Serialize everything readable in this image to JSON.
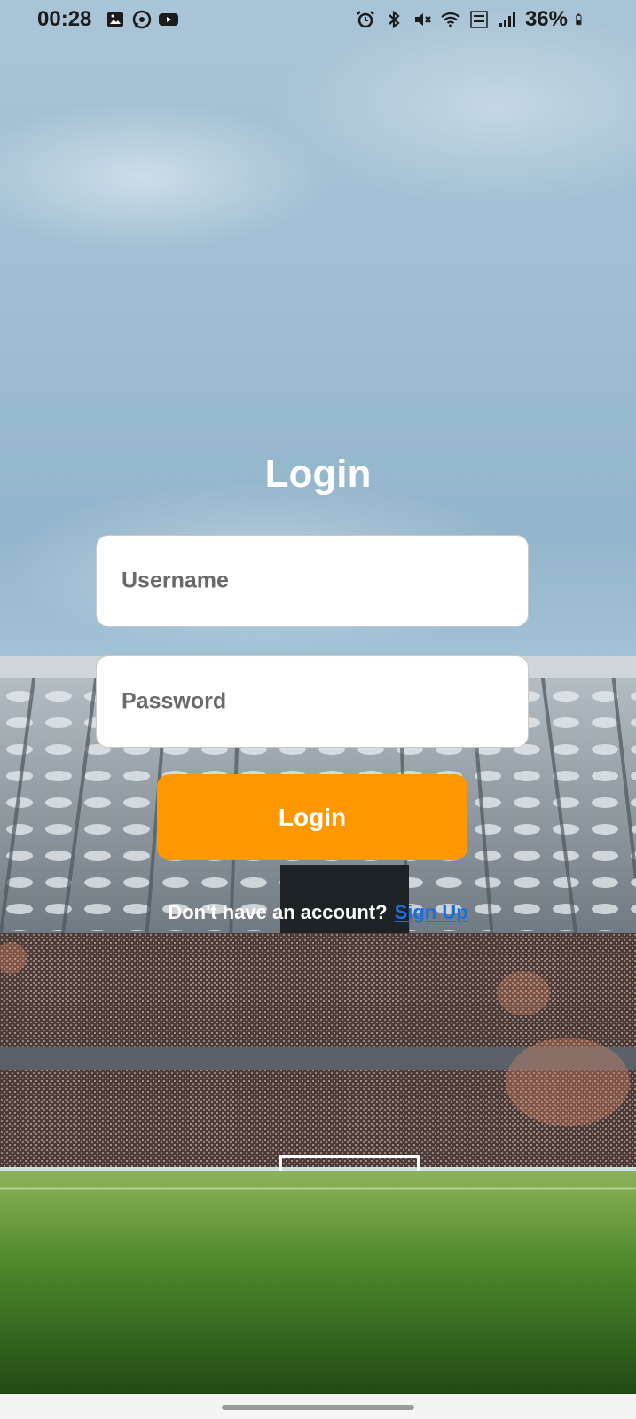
{
  "status_bar": {
    "time": "00:28",
    "battery_percent": "36%",
    "left_icons": [
      "gallery-icon",
      "whatsapp-icon",
      "youtube-icon"
    ],
    "right_icons": [
      "alarm-icon",
      "bluetooth-icon",
      "mute-icon",
      "wifi-icon",
      "volte-icon",
      "signal-icon",
      "battery-icon"
    ]
  },
  "login": {
    "title": "Login",
    "username_placeholder": "Username",
    "password_placeholder": "Password",
    "login_button": "Login",
    "signup_prompt": "Don't have an account?",
    "signup_link": "Sign Up"
  },
  "colors": {
    "accent": "#ff9800",
    "link": "#1b6fe0"
  }
}
